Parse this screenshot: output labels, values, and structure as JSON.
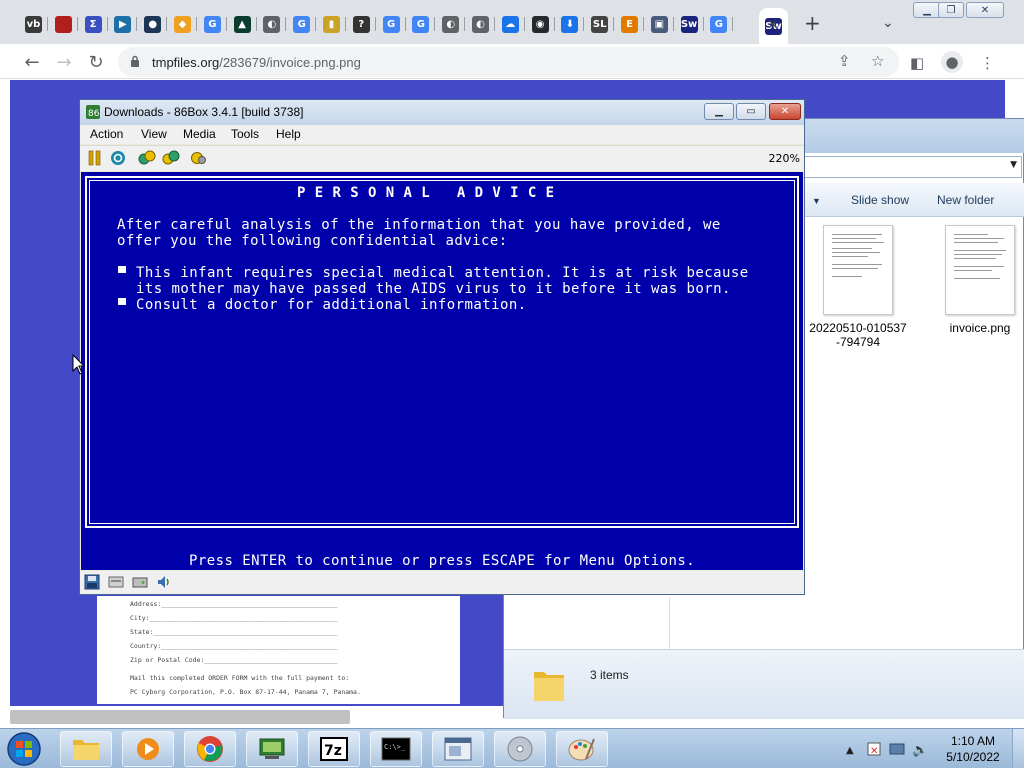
{
  "browser": {
    "tabs": [
      {
        "icon": "vb-favicon",
        "color": "#3a3a3a",
        "glyph": "vb"
      },
      {
        "icon": "red-book-favicon",
        "color": "#b3201b",
        "glyph": ""
      },
      {
        "icon": "sigma-favicon",
        "color": "#3a50c0",
        "glyph": "Σ"
      },
      {
        "icon": "play-favicon",
        "color": "#1e6fa8",
        "glyph": "▶"
      },
      {
        "icon": "circle-logo-favicon",
        "color": "#1d3557",
        "glyph": "●"
      },
      {
        "icon": "diamond-favicon",
        "color": "#f0a020",
        "glyph": "◆"
      },
      {
        "icon": "google-favicon",
        "color": "#4285f4",
        "glyph": "G"
      },
      {
        "icon": "triangle-favicon",
        "color": "#0b3d2e",
        "glyph": "▲"
      },
      {
        "icon": "globe-favicon",
        "color": "#5f6368",
        "glyph": "◐"
      },
      {
        "icon": "google-favicon",
        "color": "#4285f4",
        "glyph": "G"
      },
      {
        "icon": "chart-favicon",
        "color": "#c9a227",
        "glyph": "▮"
      },
      {
        "icon": "question-favicon",
        "color": "#333333",
        "glyph": "?"
      },
      {
        "icon": "google-favicon",
        "color": "#4285f4",
        "glyph": "G"
      },
      {
        "icon": "google-favicon",
        "color": "#4285f4",
        "glyph": "G"
      },
      {
        "icon": "globe-favicon",
        "color": "#5f6368",
        "glyph": "◐"
      },
      {
        "icon": "globe-favicon",
        "color": "#5f6368",
        "glyph": "◐"
      },
      {
        "icon": "cloud-upload-favicon",
        "color": "#1a73e8",
        "glyph": "☁"
      },
      {
        "icon": "github-favicon",
        "color": "#24292e",
        "glyph": "◉"
      },
      {
        "icon": "download-favicon",
        "color": "#1a73e8",
        "glyph": "⬇"
      },
      {
        "icon": "sl-favicon",
        "color": "#444444",
        "glyph": "SL"
      },
      {
        "icon": "e-favicon",
        "color": "#e07b00",
        "glyph": "E"
      },
      {
        "icon": "floppy-favicon",
        "color": "#4a5a7a",
        "glyph": "▣"
      },
      {
        "icon": "sw-favicon",
        "color": "#1a237e",
        "glyph": "Sw"
      },
      {
        "icon": "google-favicon",
        "color": "#4285f4",
        "glyph": "G"
      },
      {
        "icon": "sw-favicon",
        "color": "#1a237e",
        "glyph": "Sw"
      }
    ],
    "url_host": "tmpfiles.org",
    "url_path": "/283679/invoice.png.png"
  },
  "document_preview": {
    "lines": [
      "Address:_____________________________________________",
      "City:________________________________________________",
      "State:_______________________________________________",
      "Country:_____________________________________________",
      "Zip or Postal Code:__________________________________",
      "Mail this completed ORDER FORM with the full payment to:",
      "PC Cyborg Corporation, P.O. Box 87-17-44, Panama 7, Panama."
    ]
  },
  "explorer": {
    "commands": [
      "Slide show",
      "New folder"
    ],
    "files": [
      {
        "name_line1": "20220510-010537",
        "name_line2": "-794794"
      },
      {
        "name_line1": "invoice.png",
        "name_line2": ""
      }
    ],
    "status": "3 items"
  },
  "emulator": {
    "title": "Downloads - 86Box 3.4.1 [build 3738]",
    "menu": [
      "Action",
      "View",
      "Media",
      "Tools",
      "Help"
    ],
    "zoom": "220%",
    "screen": {
      "heading": "P E R S O N A L   A D V I C E",
      "intro_line1": "After careful analysis of the information that you have provided, we",
      "intro_line2": "offer you the following confidential advice:",
      "bullet1_line1": "This infant requires special medical attention. It is at risk because",
      "bullet1_line2": "its mother may have passed the AIDS virus to it before it was born.",
      "bullet2_line1": "Consult a doctor for additional information.",
      "footer": "Press ENTER to continue or press ESCAPE for Menu Options."
    }
  },
  "taskbar": {
    "time": "1:10 AM",
    "date": "5/10/2022"
  }
}
